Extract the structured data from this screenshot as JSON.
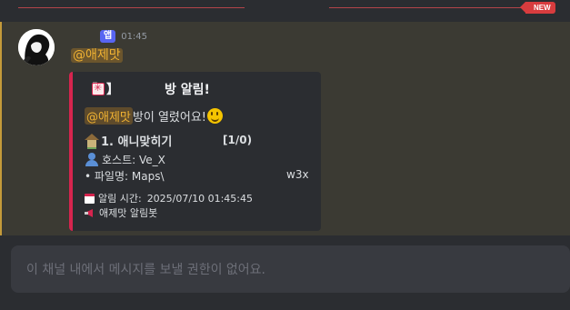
{
  "divider": {
    "new_label": "NEW"
  },
  "message": {
    "author_badge": "앱",
    "timestamp": "01:45",
    "content_mention": "@애제맛",
    "embed": {
      "title_bracket_left": "【",
      "title_bracket_right": "】",
      "title": "방 알림!",
      "desc_mention": "@애제맛",
      "desc_text": " 방이 열렸어요!",
      "room_name": "1. 애니맞히기",
      "room_count": "[1/0)",
      "host": "호스트: Ve_X",
      "file_name": "• 파일명: Maps\\",
      "file_ext": "w3x",
      "time_label": "알림 시간:",
      "time_value": "2025/07/10 01:45:45",
      "bot_name": "애제맛 알림봇"
    }
  },
  "composer": {
    "placeholder": "이 채널 내에서 메시지를 보낼 권한이 없어요."
  },
  "colors": {
    "background": "#2b2d31",
    "mention_highlight": "#3b3a33",
    "embed_accent": "#d6244e",
    "app_badge": "#5865f2",
    "new_badge": "#d83c3e"
  }
}
